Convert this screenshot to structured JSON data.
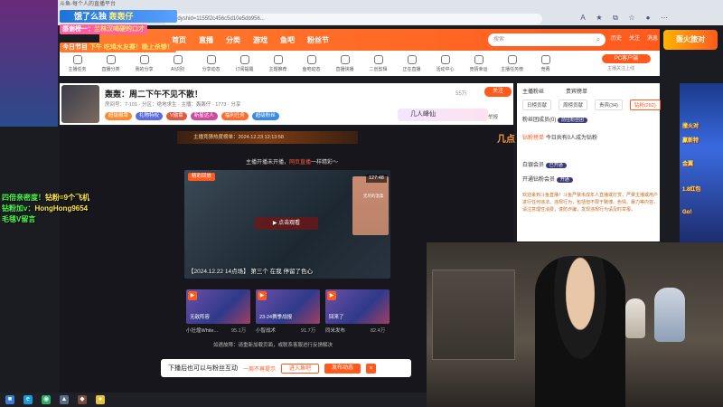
{
  "browser": {
    "tab_title": "斗鱼-每个人的直播平台",
    "url": "45.dyshid=1155f2c456c5d10e5db956..."
  },
  "overlay": {
    "top_banner_a": "饿了么独",
    "top_banner_b": "轰轰仔",
    "line1_prefix": "感谢榜一：",
    "line1_name": "兰林汉喝硬的口才",
    "line2_prefix": "今日节目",
    "line2_text": "下午 吃鸡水友赛！晚上杀惨！",
    "green_lines": [
      {
        "a": "四倍亲密度！",
        "b": "钻粉=9个飞机"
      },
      {
        "a": "钻粉加v：",
        "b": "HongHong9654"
      },
      {
        "a": "毛毯V留言",
        "b": ""
      }
    ],
    "right_labels": [
      "撞火对",
      "赢新特",
      "金翼",
      "1.8红包",
      "Go!"
    ],
    "logo": "轰火旅对"
  },
  "header": {
    "nav": [
      "首页",
      "直播",
      "分类",
      "游戏",
      "鱼吧",
      "粉丝节"
    ],
    "search_placeholder": "搜索",
    "right_items": [
      "历史",
      "关注",
      "消息"
    ]
  },
  "categories": [
    {
      "label": "主播任务"
    },
    {
      "label": "直播分类"
    },
    {
      "label": "我的分享"
    },
    {
      "label": "AI识别"
    },
    {
      "label": "分享动态"
    },
    {
      "label": "订阅提醒"
    },
    {
      "label": "主题推荐"
    },
    {
      "label": "鱼吧动态"
    },
    {
      "label": "直播快播"
    },
    {
      "label": "二创剪辑"
    },
    {
      "label": "正在直播"
    },
    {
      "label": "活动中心"
    },
    {
      "label": "竞猜幸运"
    },
    {
      "label": "主播任务榜"
    },
    {
      "label": "竞赛"
    }
  ],
  "client": {
    "pc_label": "PC客户端",
    "fav_label": "主播关注上线"
  },
  "room": {
    "title": "轰轰：周二下午不见不散！",
    "sub": "房间号：7-101 · 分区：绝地求生 · 主播：轰轰仔 · 1773  · 分享",
    "badges": [
      {
        "text": "超级徽章",
        "color": "#ff8a2e"
      },
      {
        "text": "礼物特权",
        "color": "#5a6ae0"
      },
      {
        "text": "V勋章",
        "color": "#e05a3e"
      },
      {
        "text": "新星达人",
        "color": "#d04aa0"
      },
      {
        "text": "福利任务",
        "color": "#ff6a2e"
      },
      {
        "text": "超级粉丝",
        "color": "#3a8ae0"
      }
    ],
    "followers": "55万",
    "follow_label": "关注",
    "gift_banner": "几人峰仙",
    "report": "举报"
  },
  "right_panel": {
    "tabs1": [
      "主播粉丝",
      "贵宾榜单"
    ],
    "tabs2": [
      {
        "label": "日榜贡献",
        "active": false
      },
      {
        "label": "周榜贡献",
        "active": false
      },
      {
        "label": "贵宾(34)",
        "active": false
      },
      {
        "label": "钻粉(282)",
        "active": true
      }
    ],
    "rows": [
      {
        "text": "粉丝团成员(0)",
        "action": "前往粉丝团"
      },
      {
        "text": "钻粉榜单",
        "action": "今日共有0人成为钻粉"
      },
      {
        "text": "白银会员",
        "action": "已开通"
      },
      {
        "text": "开通钻粉会员",
        "action": "开通"
      }
    ],
    "notice": "欢迎来到斗鱼直播！斗鱼严禁未成年人直播或打赏，严禁主播或用户进行任何违法、违规行为，包括但不限于赌博、色情、暴力等内容。请注意理性消费，谨防诈骗，发现违规行为请及时举报。"
  },
  "content": {
    "title_strip": "主播竞猜热度榜单：2024.12.23 12:13:58",
    "jidian": "几点",
    "announce_prefix": "主播开播未开播，",
    "announce_em": "网页直播",
    "announce_suffix": "一样精彩～",
    "video": {
      "tag": "精彩回放",
      "duration": "127:48",
      "play": "▶ 点击观看",
      "caption": "【2024.12.22 14点场】 第三个 在我 停留了色心",
      "side_text": "无尽的温柔"
    },
    "thumbs": [
      {
        "name": "小壮煌White...",
        "views": "95.1万",
        "mid": "无敌阵容"
      },
      {
        "name": "小智战术",
        "views": "91.7万",
        "mid": "23-24赛季战报"
      },
      {
        "name": "同米发布",
        "views": "82.4万",
        "mid": "回来了"
      }
    ],
    "footer_note": "如遇故障：请重新加载页面，或联系客服进行反馈解决"
  },
  "toast": {
    "text": "下播后也可以与粉丝互动",
    "link": "一周不再提示",
    "btn_ghost": "进入鱼吧",
    "btn_solid": "发布动态",
    "close": "×"
  },
  "colors": {
    "accent": "#ff5a1e",
    "green_overlay": "#4cff4c"
  }
}
